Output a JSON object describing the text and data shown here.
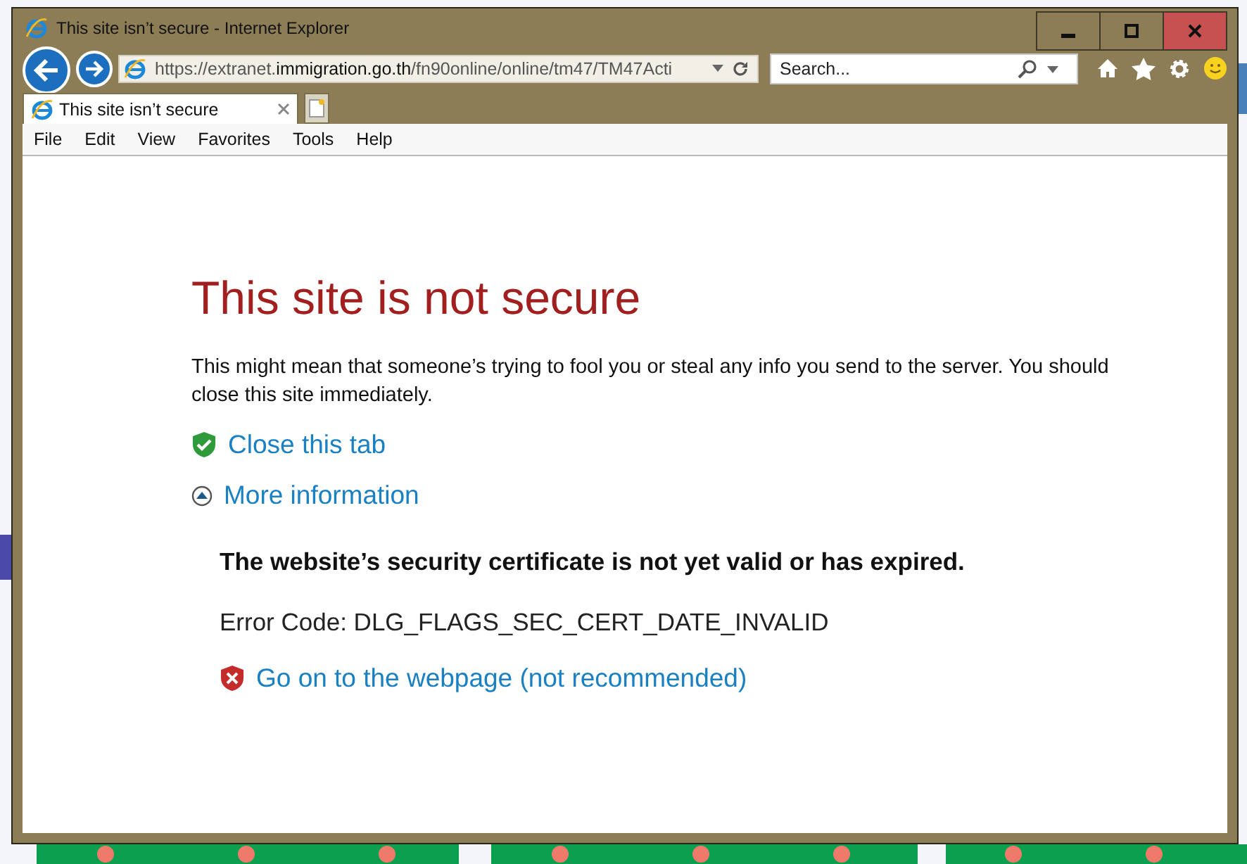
{
  "window": {
    "title": "This site isn’t secure - Internet Explorer"
  },
  "address_bar": {
    "url_prefix": "https://extranet.",
    "url_domain": "immigration.go.th",
    "url_path": "/fn90online/online/tm47/TM47Acti"
  },
  "search": {
    "placeholder": "Search..."
  },
  "tabs": [
    {
      "label": "This site isn’t secure",
      "selected": true
    }
  ],
  "menu": [
    "File",
    "Edit",
    "View",
    "Favorites",
    "Tools",
    "Help"
  ],
  "page": {
    "heading": "This site is not secure",
    "message": "This might mean that someone’s trying to fool you or steal any info you send to the server. You should close this site immediately.",
    "actions": [
      {
        "kind": "safe",
        "label": "Close this tab"
      },
      {
        "kind": "expander",
        "label": "More information",
        "expanded": true
      }
    ],
    "details": {
      "reason": "The website’s security certificate is not yet valid or has expired.",
      "error_code": "Error Code: DLG_FLAGS_SEC_CERT_DATE_INVALID",
      "proceed_link": "Go on to the webpage (not recommended)"
    }
  }
}
